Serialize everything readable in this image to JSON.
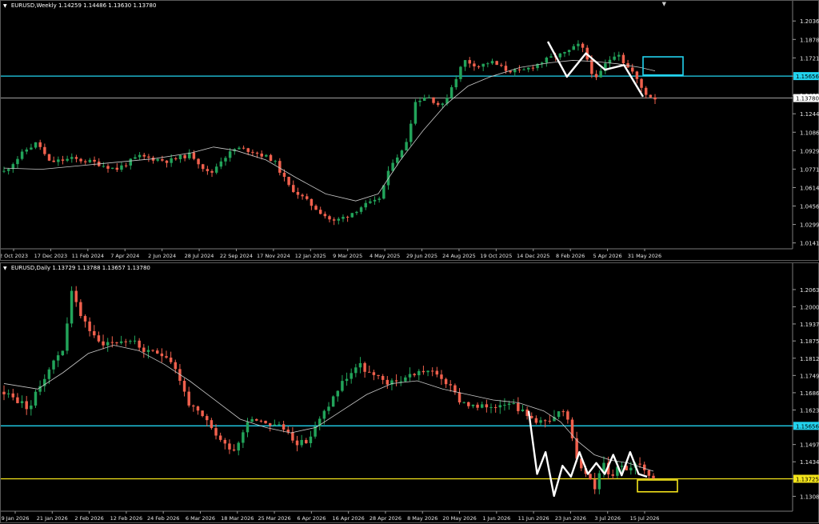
{
  "panels": [
    {
      "id": "weekly",
      "header": {
        "symbol": "EURUSD,Weekly",
        "ohlc": "1.14259 1.14486 1.13630 1.13780"
      },
      "chart_data": {
        "type": "candlestick",
        "title": "EURUSD,Weekly",
        "ylim": [
          1.0105,
          1.214
        ],
        "y_ticks": [
          "1.20360",
          "1.18785",
          "1.17210",
          "1.15656",
          "1.14015",
          "1.12440",
          "1.10865",
          "1.09290",
          "1.07715",
          "1.06140",
          "1.04565",
          "1.02990",
          "1.01415"
        ],
        "x_ticks": [
          "2 Oct 2023",
          "17 Dec 2023",
          "11 Feb 2024",
          "7 Apr 2024",
          "2 Jun 2024",
          "28 Jul 2024",
          "22 Sep 2024",
          "17 Nov 2024",
          "12 Jan 2025",
          "9 Mar 2025",
          "4 May 2025",
          "29 Jun 2025",
          "24 Aug 2025",
          "19 Oct 2025",
          "14 Dec 2025",
          "8 Feb 2026",
          "5 Apr 2026",
          "31 May 2026"
        ],
        "candle_count": 145,
        "price_path": [
          [
            0,
            1.075
          ],
          [
            6,
            1.094
          ],
          [
            9,
            1.1
          ],
          [
            12,
            1.083
          ],
          [
            18,
            1.086
          ],
          [
            24,
            1.083
          ],
          [
            30,
            1.077
          ],
          [
            36,
            1.088
          ],
          [
            44,
            1.084
          ],
          [
            50,
            1.09
          ],
          [
            55,
            1.072
          ],
          [
            58,
            1.085
          ],
          [
            62,
            1.095
          ],
          [
            66,
            1.093
          ],
          [
            72,
            1.085
          ],
          [
            76,
            1.063
          ],
          [
            82,
            1.047
          ],
          [
            88,
            1.032
          ],
          [
            92,
            1.038
          ],
          [
            96,
            1.046
          ],
          [
            100,
            1.05
          ],
          [
            104,
            1.085
          ],
          [
            107,
            1.094
          ],
          [
            110,
            1.135
          ],
          [
            113,
            1.14
          ],
          [
            117,
            1.13
          ],
          [
            120,
            1.15
          ],
          [
            123,
            1.17
          ],
          [
            127,
            1.165
          ],
          [
            130,
            1.169
          ],
          [
            134,
            1.162
          ],
          [
            138,
            1.16
          ],
          [
            142,
            1.166
          ],
          [
            146,
            1.172
          ],
          [
            150,
            1.176
          ],
          [
            154,
            1.184
          ],
          [
            156,
            1.17
          ],
          [
            158,
            1.152
          ],
          [
            161,
            1.168
          ],
          [
            164,
            1.178
          ],
          [
            166,
            1.166
          ],
          [
            168,
            1.16
          ],
          [
            170,
            1.148
          ],
          [
            172,
            1.14
          ],
          [
            174,
            1.1378
          ]
        ],
        "ma_path": [
          [
            0,
            1.078
          ],
          [
            10,
            1.077
          ],
          [
            20,
            1.08
          ],
          [
            30,
            1.083
          ],
          [
            40,
            1.086
          ],
          [
            50,
            1.091
          ],
          [
            56,
            1.096
          ],
          [
            62,
            1.093
          ],
          [
            70,
            1.085
          ],
          [
            78,
            1.07
          ],
          [
            86,
            1.056
          ],
          [
            94,
            1.05
          ],
          [
            100,
            1.056
          ],
          [
            106,
            1.085
          ],
          [
            112,
            1.11
          ],
          [
            118,
            1.132
          ],
          [
            124,
            1.148
          ],
          [
            130,
            1.156
          ],
          [
            138,
            1.164
          ],
          [
            146,
            1.168
          ],
          [
            152,
            1.17
          ],
          [
            158,
            1.169
          ],
          [
            164,
            1.167
          ],
          [
            170,
            1.164
          ],
          [
            174,
            1.161
          ]
        ],
        "pattern_line": [
          [
            1.186
          ],
          [
            1.156
          ],
          [
            1.176
          ],
          [
            1.162
          ],
          [
            1.166
          ],
          [
            1.139
          ]
        ],
        "levels": [
          {
            "price": 1.15656,
            "label": "1.15656",
            "color": "#22d3ee"
          },
          {
            "price": 1.1378,
            "label": "1.13780",
            "color": "#ffffff"
          }
        ],
        "target_box": {
          "color": "#22d3ee",
          "price_top": 1.173,
          "price_bottom": 1.1575
        },
        "colors": {
          "up": "#22a35a",
          "down": "#f0604d",
          "ma": "#c8c8c8",
          "pattern": "#ffffff"
        }
      }
    },
    {
      "id": "daily",
      "header": {
        "symbol": "EURUSD,Daily",
        "ohlc": "1.13729 1.13788 1.13657 1.13780"
      },
      "chart_data": {
        "type": "candlestick",
        "title": "EURUSD,Daily",
        "ylim": [
          1.126,
          1.213
        ],
        "y_ticks": [
          "1.20630",
          "1.20000",
          "1.19375",
          "1.18755",
          "1.18125",
          "1.17495",
          "1.16865",
          "1.16235",
          "1.15656",
          "1.14975",
          "1.14345",
          "1.13725",
          "1.13085"
        ],
        "x_ticks": [
          "9 Jan 2026",
          "21 Jan 2026",
          "2 Feb 2026",
          "12 Feb 2026",
          "24 Feb 2026",
          "6 Mar 2026",
          "18 Mar 2026",
          "25 Mar 2026",
          "6 Apr 2026",
          "16 Apr 2026",
          "28 Apr 2026",
          "8 May 2026",
          "20 May 2026",
          "1 Jun 2026",
          "11 Jun 2026",
          "23 Jun 2026",
          "3 Jul 2026",
          "15 Jul 2026"
        ],
        "candle_count": 145,
        "price_path": [
          [
            0,
            1.169
          ],
          [
            6,
            1.163
          ],
          [
            10,
            1.176
          ],
          [
            14,
            1.185
          ],
          [
            16,
            1.205
          ],
          [
            18,
            1.198
          ],
          [
            22,
            1.187
          ],
          [
            26,
            1.187
          ],
          [
            30,
            1.188
          ],
          [
            34,
            1.183
          ],
          [
            38,
            1.183
          ],
          [
            40,
            1.18
          ],
          [
            44,
            1.164
          ],
          [
            48,
            1.158
          ],
          [
            52,
            1.15
          ],
          [
            55,
            1.148
          ],
          [
            58,
            1.16
          ],
          [
            62,
            1.158
          ],
          [
            66,
            1.156
          ],
          [
            70,
            1.15
          ],
          [
            72,
            1.151
          ],
          [
            75,
            1.159
          ],
          [
            80,
            1.172
          ],
          [
            84,
            1.179
          ],
          [
            88,
            1.174
          ],
          [
            92,
            1.172
          ],
          [
            96,
            1.175
          ],
          [
            100,
            1.177
          ],
          [
            104,
            1.174
          ],
          [
            108,
            1.166
          ],
          [
            112,
            1.163
          ],
          [
            116,
            1.164
          ],
          [
            120,
            1.166
          ],
          [
            124,
            1.16
          ],
          [
            128,
            1.158
          ],
          [
            130,
            1.158
          ],
          [
            132,
            1.162
          ],
          [
            134,
            1.158
          ],
          [
            136,
            1.144
          ],
          [
            138,
            1.14
          ],
          [
            140,
            1.133
          ],
          [
            142,
            1.143
          ],
          [
            144,
            1.138
          ],
          [
            146,
            1.143
          ],
          [
            148,
            1.141
          ],
          [
            150,
            1.144
          ],
          [
            152,
            1.141
          ],
          [
            154,
            1.1378
          ]
        ],
        "ma_path": [
          [
            0,
            1.172
          ],
          [
            8,
            1.17
          ],
          [
            14,
            1.176
          ],
          [
            20,
            1.183
          ],
          [
            26,
            1.186
          ],
          [
            32,
            1.184
          ],
          [
            38,
            1.179
          ],
          [
            44,
            1.173
          ],
          [
            50,
            1.166
          ],
          [
            56,
            1.159
          ],
          [
            62,
            1.156
          ],
          [
            68,
            1.154
          ],
          [
            74,
            1.156
          ],
          [
            80,
            1.162
          ],
          [
            86,
            1.168
          ],
          [
            92,
            1.172
          ],
          [
            98,
            1.173
          ],
          [
            104,
            1.17
          ],
          [
            110,
            1.168
          ],
          [
            116,
            1.166
          ],
          [
            122,
            1.165
          ],
          [
            128,
            1.162
          ],
          [
            132,
            1.158
          ],
          [
            136,
            1.151
          ],
          [
            140,
            1.146
          ],
          [
            144,
            1.144
          ],
          [
            148,
            1.143
          ],
          [
            152,
            1.141
          ],
          [
            154,
            1.14
          ]
        ],
        "pattern_line": [
          [
            1.162
          ],
          [
            1.139
          ],
          [
            1.147
          ],
          [
            1.131
          ],
          [
            1.142
          ],
          [
            1.138
          ],
          [
            1.147
          ],
          [
            1.139
          ],
          [
            1.143
          ],
          [
            1.139
          ],
          [
            1.146
          ],
          [
            1.1385
          ],
          [
            1.147
          ],
          [
            1.139
          ],
          [
            1.138
          ]
        ],
        "levels": [
          {
            "price": 1.15656,
            "label": "1.15656",
            "color": "#22d3ee"
          },
          {
            "price": 1.13725,
            "label": "1.13725",
            "color": "#f5e51b"
          }
        ],
        "target_box": {
          "color": "#f5e51b",
          "price_top": 1.1368,
          "price_bottom": 1.1325
        },
        "colors": {
          "up": "#22a35a",
          "down": "#f0604d",
          "ma": "#c8c8c8",
          "pattern": "#ffffff"
        }
      }
    }
  ]
}
